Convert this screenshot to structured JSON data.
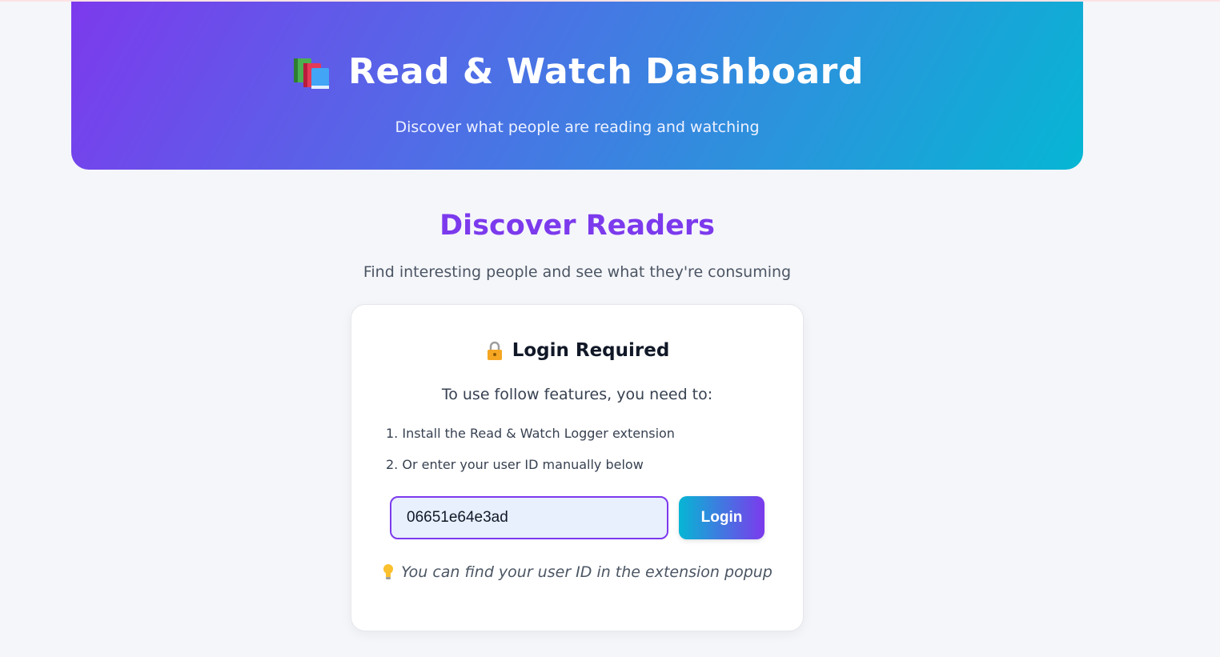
{
  "header": {
    "icon": "books-icon",
    "title": "Read & Watch Dashboard",
    "subtitle": "Discover what people are reading and watching"
  },
  "section": {
    "title": "Discover Readers",
    "subtitle": "Find interesting people and see what they're consuming"
  },
  "login_card": {
    "icon": "lock-icon",
    "title": "Login Required",
    "intro": "To use follow features, you need to:",
    "steps": [
      "1. Install the Read & Watch Logger extension",
      "2. Or enter your user ID manually below"
    ],
    "user_id_value": "06651e64e3ad",
    "login_label": "Login",
    "hint_icon": "lightbulb-icon",
    "hint": "You can find your user ID in the extension popup"
  },
  "colors": {
    "accent_purple": "#7c3aed",
    "accent_cyan": "#06b6d4",
    "background": "#f5f6fa"
  }
}
